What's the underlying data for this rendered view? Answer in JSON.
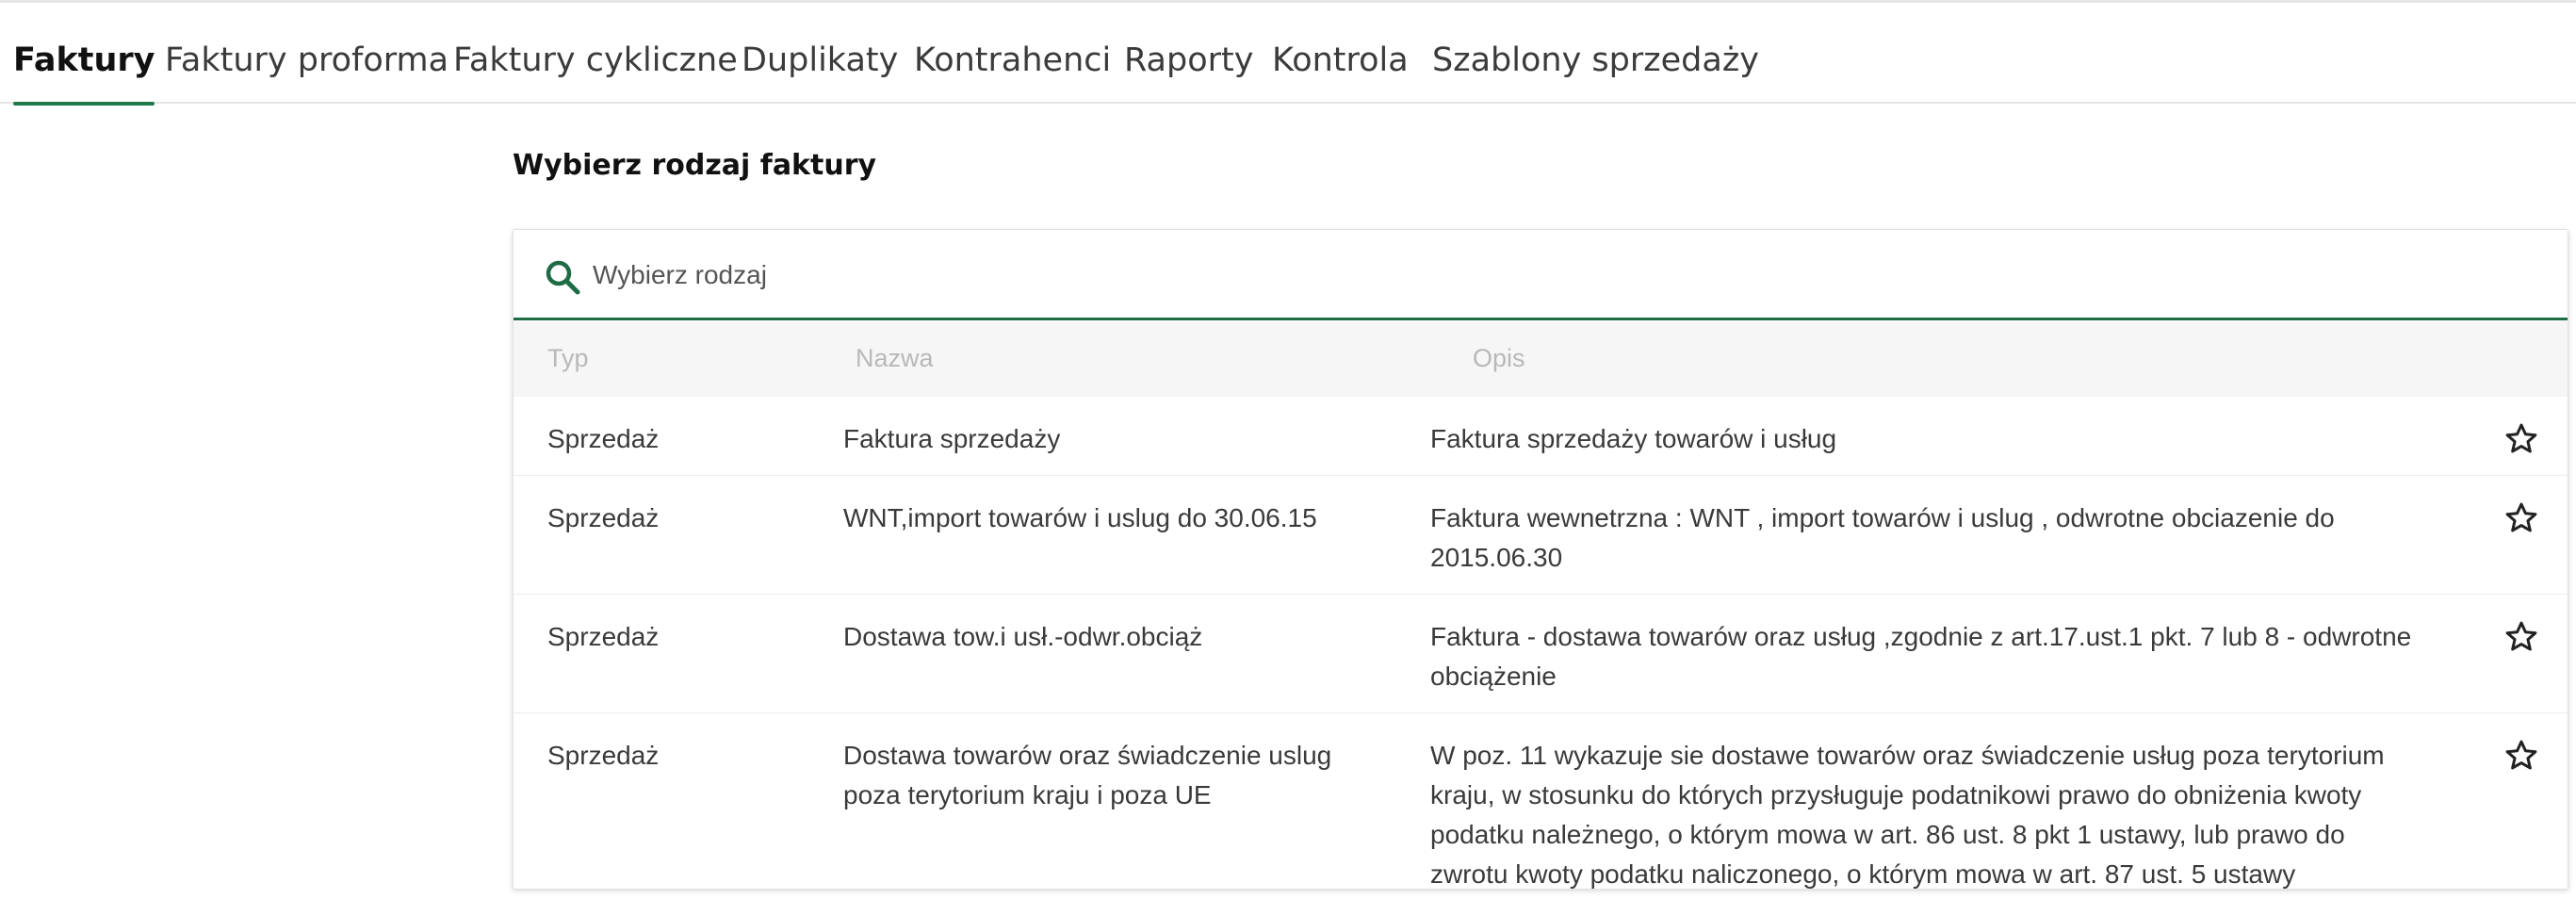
{
  "tabs": [
    {
      "label": "Faktury",
      "active": true
    },
    {
      "label": "Faktury proforma"
    },
    {
      "label": "Faktury cykliczne"
    },
    {
      "label": "Duplikaty"
    },
    {
      "label": "Kontrahenci"
    },
    {
      "label": "Raporty"
    },
    {
      "label": "Kontrola"
    },
    {
      "label": "Szablony sprzedaży"
    }
  ],
  "heading": "Wybierz rodzaj faktury",
  "search": {
    "placeholder": "Wybierz rodzaj",
    "value": "",
    "icon": "search-icon"
  },
  "table": {
    "columns": [
      "Typ",
      "Nazwa",
      "Opis"
    ],
    "rows": [
      {
        "typ": "Sprzedaż",
        "nazwa": "Faktura sprzedaży",
        "opis": "Faktura sprzedaży towarów i usług",
        "icon": "star-icon"
      },
      {
        "typ": "Sprzedaż",
        "nazwa": "WNT,import towarów i uslug do 30.06.15",
        "opis": "Faktura wewnetrzna : WNT , import towarów i uslug , odwrotne obciazenie do 2015.06.30",
        "icon": "star-icon"
      },
      {
        "typ": "Sprzedaż",
        "nazwa": "Dostawa tow.i usł.-odwr.obciąż",
        "opis": "Faktura - dostawa towarów oraz usług ,zgodnie z art.17.ust.1 pkt. 7 lub 8 - odwrotne obciążenie",
        "icon": "star-icon"
      },
      {
        "typ": "Sprzedaż",
        "nazwa": "Dostawa towarów oraz świadczenie uslug poza terytorium kraju i poza UE",
        "opis": "W poz. 11 wykazuje sie dostawe towarów oraz świadczenie usług poza terytorium kraju, w stosunku do których przysługuje podatnikowi prawo do obniżenia kwoty podatku należnego, o którym mowa w art. 86 ust. 8 pkt 1 ustawy, lub prawo do zwrotu kwoty podatku naliczonego, o którym mowa w art. 87 ust. 5 ustawy",
        "icon": "star-icon"
      }
    ]
  },
  "colors": {
    "accent": "#1e7a4c",
    "search_underline": "#1e6b46"
  }
}
